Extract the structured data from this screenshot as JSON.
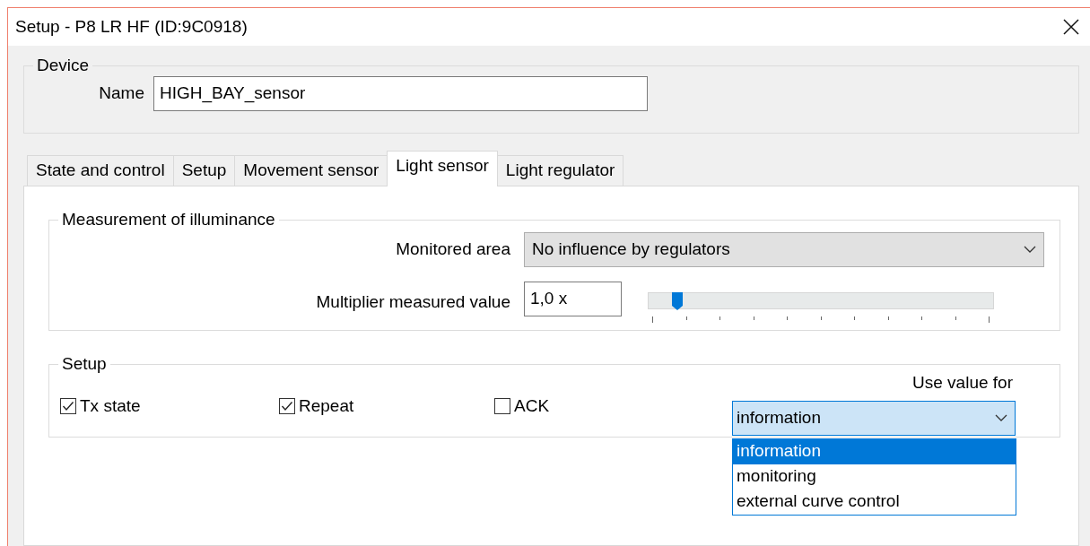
{
  "window": {
    "title": "Setup - P8 LR HF (ID:9C0918)"
  },
  "device": {
    "legend": "Device",
    "name_label": "Name",
    "name_value": "HIGH_BAY_sensor"
  },
  "tabs": [
    {
      "label": "State and control",
      "selected": false
    },
    {
      "label": "Setup",
      "selected": false
    },
    {
      "label": "Movement sensor",
      "selected": false
    },
    {
      "label": "Light sensor",
      "selected": true
    },
    {
      "label": "Light regulator",
      "selected": false
    }
  ],
  "illuminance": {
    "legend": "Measurement of illuminance",
    "monitored_area": {
      "label": "Monitored area",
      "value": "No influence by regulators"
    },
    "multiplier": {
      "label": "Multiplier measured value",
      "value": "1,0 x",
      "level": 0.07
    }
  },
  "setup": {
    "legend": "Setup",
    "checkboxes": [
      {
        "label": "Tx state",
        "checked": true
      },
      {
        "label": "Repeat",
        "checked": true
      },
      {
        "label": "ACK",
        "checked": false
      }
    ],
    "use_value_for": {
      "label": "Use value for",
      "value": "information",
      "expanded": true,
      "options": [
        {
          "label": "information",
          "selected": true
        },
        {
          "label": "monitoring",
          "selected": false
        },
        {
          "label": "external curve control",
          "selected": false
        }
      ]
    }
  }
}
